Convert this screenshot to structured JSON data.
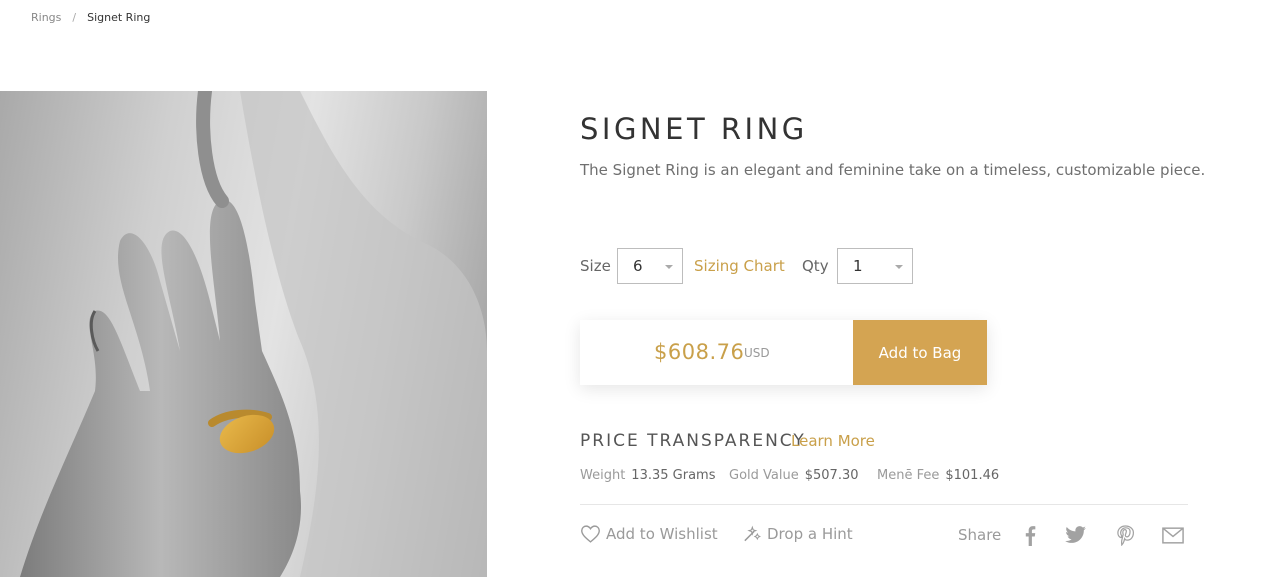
{
  "breadcrumb": {
    "parent": "Rings",
    "separator": "/",
    "current": "Signet Ring"
  },
  "product": {
    "title": "SIGNET RING",
    "description": "The Signet Ring is an elegant and feminine take on a timeless, customizable piece."
  },
  "options": {
    "size_label": "Size",
    "size_value": "6",
    "sizing_chart_label": "Sizing Chart",
    "qty_label": "Qty",
    "qty_value": "1"
  },
  "purchase": {
    "price": "$608.76",
    "currency": "USD",
    "add_to_bag_label": "Add to Bag"
  },
  "price_transparency": {
    "title": "PRICE TRANSPARENCY",
    "learn_more_label": "Learn More",
    "weight_label": "Weight",
    "weight_value": "13.35 Grams",
    "gold_value_label": "Gold Value",
    "gold_value": "$507.30",
    "fee_label": "Menē Fee",
    "fee_value": "$101.46"
  },
  "actions": {
    "wishlist_label": "Add to Wishlist",
    "hint_label": "Drop a Hint",
    "share_label": "Share"
  },
  "icons": [
    "heart-icon",
    "wand-icon",
    "facebook-icon",
    "twitter-icon",
    "pinterest-icon",
    "mail-icon"
  ],
  "colors": {
    "accent": "#c9a04a",
    "button": "#d4a452"
  }
}
